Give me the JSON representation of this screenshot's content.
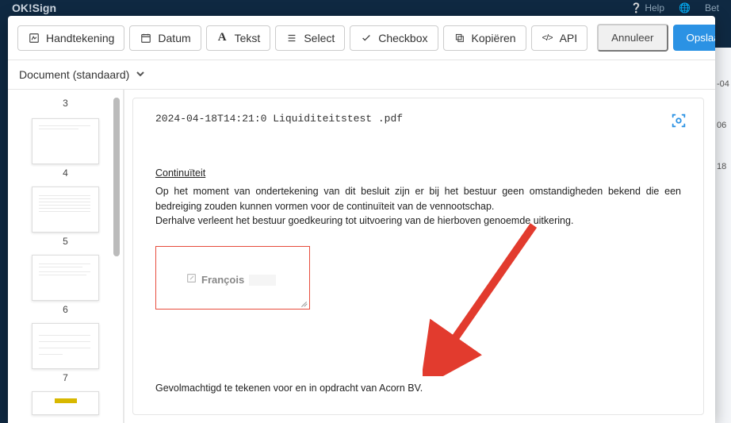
{
  "header": {
    "brand": "OK!Sign",
    "help": "Help",
    "right": "Bet"
  },
  "toolbar": {
    "handtekening": "Handtekening",
    "datum": "Datum",
    "tekst": "Tekst",
    "select": "Select",
    "checkbox": "Checkbox",
    "kopieren": "Kopiëren",
    "api": "API",
    "annuleer": "Annuleer",
    "opslaan": "Opslaan"
  },
  "subbar": {
    "docname": "Document (standaard)"
  },
  "thumbs": [
    "3",
    "4",
    "5",
    "6",
    "7"
  ],
  "doc": {
    "title": "2024-04-18T14:21:0 Liquiditeitstest .pdf",
    "section": "Continuïteit",
    "para1a": "Op het moment van ondertekening van dit besluit zijn er bij het bestuur geen omstandigheden bekend die een bedreiging zouden kunnen vormen voor de continuïteit van de vennootschap.",
    "para1b": "Derhalve verleent het bestuur goedkeuring tot uitvoering van de hierboven genoemde uitkering.",
    "sig_name": "François",
    "para2": "Gevolmachtigd te tekenen voor en in opdracht van Acorn BV."
  },
  "bg_rows": [
    "-04",
    "06",
    "18"
  ]
}
